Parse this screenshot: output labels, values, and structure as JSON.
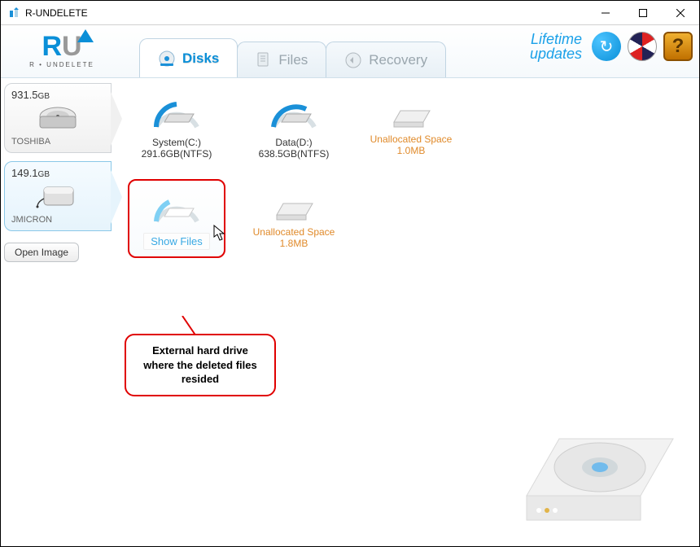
{
  "window": {
    "title": "R-UNDELETE"
  },
  "logo": {
    "mark": "R",
    "sub": "R • UNDELETE"
  },
  "tabs": [
    {
      "id": "disks",
      "label": "Disks",
      "active": true
    },
    {
      "id": "files",
      "label": "Files",
      "active": false
    },
    {
      "id": "recovery",
      "label": "Recovery",
      "active": false
    }
  ],
  "lifetime": {
    "line1": "Lifetime",
    "line2": "updates"
  },
  "sidebar": {
    "drives": [
      {
        "size_val": "931.5",
        "size_unit": "GB",
        "name": "TOSHIBA",
        "active": false
      },
      {
        "size_val": "149.1",
        "size_unit": "GB",
        "name": "JMICRON",
        "active": true
      }
    ],
    "open_image_label": "Open Image"
  },
  "rows": [
    {
      "volumes": [
        {
          "type": "ntfs",
          "label": "System(C:)",
          "sub": "291.6GB(NTFS)"
        },
        {
          "type": "ntfs",
          "label": "Data(D:)",
          "sub": "638.5GB(NTFS)"
        },
        {
          "type": "unalloc",
          "label": "Unallocated Space",
          "sub": "1.0MB"
        }
      ]
    },
    {
      "volumes": [
        {
          "type": "show",
          "show_label": "Show Files",
          "highlighted": true
        },
        {
          "type": "unalloc",
          "label": "Unallocated Space",
          "sub": "1.8MB"
        }
      ]
    }
  ],
  "callout": "External hard drive where the deleted files resided"
}
